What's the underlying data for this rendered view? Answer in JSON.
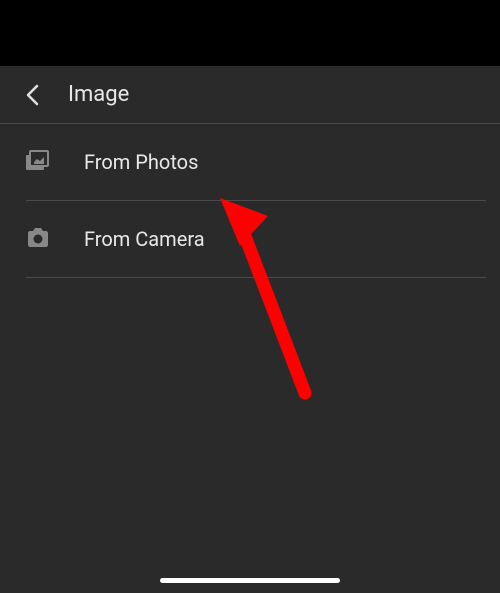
{
  "header": {
    "title": "Image"
  },
  "menu": {
    "items": [
      {
        "label": "From Photos",
        "icon": "photos-icon"
      },
      {
        "label": "From Camera",
        "icon": "camera-icon"
      }
    ]
  },
  "annotation": {
    "arrow_color": "#ff0000"
  }
}
